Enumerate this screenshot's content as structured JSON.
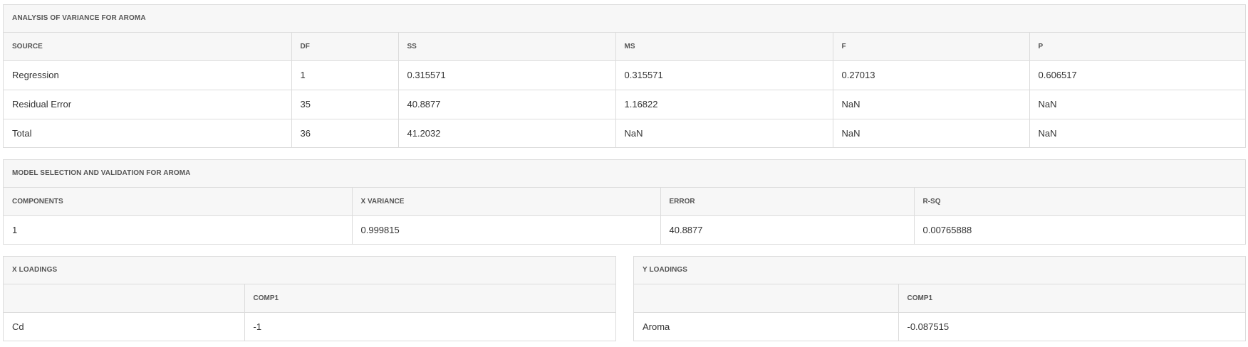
{
  "anova": {
    "title": "ANALYSIS OF VARIANCE FOR AROMA",
    "headers": [
      "SOURCE",
      "DF",
      "SS",
      "MS",
      "F",
      "P"
    ],
    "rows": [
      [
        "Regression",
        "1",
        "0.315571",
        "0.315571",
        "0.27013",
        "0.606517"
      ],
      [
        "Residual Error",
        "35",
        "40.8877",
        "1.16822",
        "NaN",
        "NaN"
      ],
      [
        "Total",
        "36",
        "41.2032",
        "NaN",
        "NaN",
        "NaN"
      ]
    ]
  },
  "model": {
    "title": "MODEL SELECTION AND VALIDATION FOR AROMA",
    "headers": [
      "COMPONENTS",
      "X VARIANCE",
      "ERROR",
      "R-SQ"
    ],
    "rows": [
      [
        "1",
        "0.999815",
        "40.8877",
        "0.00765888"
      ]
    ]
  },
  "xloadings": {
    "title": "X LOADINGS",
    "headers": [
      "",
      "COMP1"
    ],
    "rows": [
      [
        "Cd",
        "-1"
      ]
    ]
  },
  "yloadings": {
    "title": "Y LOADINGS",
    "headers": [
      "",
      "COMP1"
    ],
    "rows": [
      [
        "Aroma",
        "-0.087515"
      ]
    ]
  }
}
